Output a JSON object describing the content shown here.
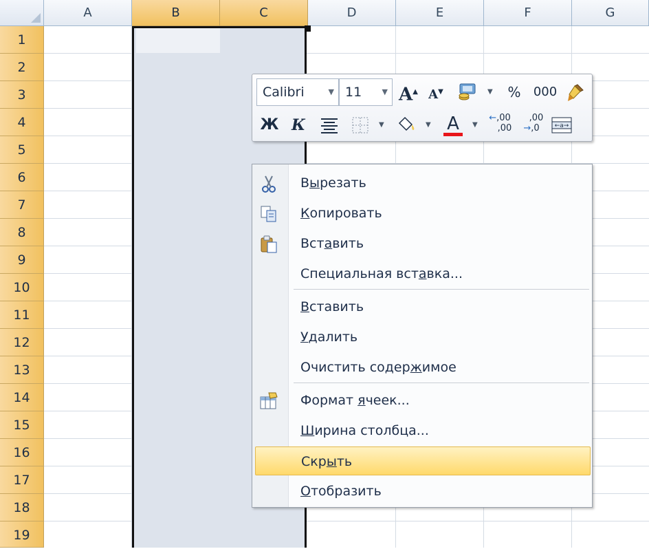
{
  "columns": [
    "A",
    "B",
    "C",
    "D",
    "E",
    "F",
    "G"
  ],
  "selected_columns": [
    "B",
    "C"
  ],
  "rows": [
    "1",
    "2",
    "3",
    "4",
    "5",
    "6",
    "7",
    "8",
    "9",
    "10",
    "11",
    "12",
    "13",
    "14",
    "15",
    "16",
    "17",
    "18",
    "19"
  ],
  "mini_toolbar": {
    "font_name": "Calibri",
    "font_size": "11",
    "grow_font": "A",
    "shrink_font": "A",
    "percent": "%",
    "thousands": "000",
    "bold": "Ж",
    "italic": "К",
    "font_color": "A",
    "inc_decimal": ",00",
    "dec_decimal": ",00",
    "font_color_swatch": "#e8161b"
  },
  "context_menu": {
    "items": [
      {
        "pre": "В",
        "u": "ы",
        "post": "резать",
        "icon": "scissors-icon"
      },
      {
        "pre": "",
        "u": "К",
        "post": "опировать",
        "icon": "copy-icon"
      },
      {
        "pre": "Вст",
        "u": "а",
        "post": "вить",
        "icon": "paste-icon"
      },
      {
        "pre": "Специальная вст",
        "u": "а",
        "post": "вка...",
        "icon": ""
      },
      {
        "pre": "",
        "u": "В",
        "post": "ставить",
        "icon": ""
      },
      {
        "pre": "",
        "u": "У",
        "post": "далить",
        "icon": ""
      },
      {
        "pre": "Очистить содер",
        "u": "ж",
        "post": "имое",
        "icon": ""
      },
      {
        "pre": "Формат ",
        "u": "я",
        "post": "чеек...",
        "icon": "format-cells-icon"
      },
      {
        "pre": "",
        "u": "Ш",
        "post": "ирина столбца...",
        "icon": ""
      },
      {
        "pre": "Скр",
        "u": "ы",
        "post": "ть",
        "icon": ""
      },
      {
        "pre": "",
        "u": "О",
        "post": "тобразить",
        "icon": ""
      }
    ]
  }
}
